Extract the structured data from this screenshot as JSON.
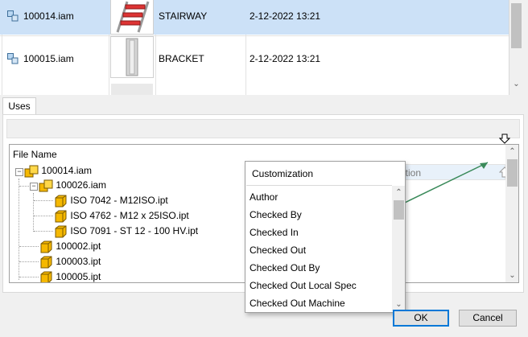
{
  "results": {
    "rows": [
      {
        "file": "100014.iam",
        "description": "STAIRWAY",
        "date": "2-12-2022 13:21",
        "selected": true
      },
      {
        "file": "100015.iam",
        "description": "BRACKET",
        "date": "2-12-2022 13:21",
        "selected": false
      }
    ]
  },
  "uses_tab": {
    "label": "Uses"
  },
  "tree": {
    "header": "File Name",
    "items": [
      {
        "label": "100014.iam",
        "level": 0,
        "kind": "assembly"
      },
      {
        "label": "100026.iam",
        "level": 1,
        "kind": "assembly"
      },
      {
        "label": "ISO 7042 - M12ISO.ipt",
        "level": 2,
        "kind": "part"
      },
      {
        "label": "ISO 4762 - M12 x 25ISO.ipt",
        "level": 2,
        "kind": "part"
      },
      {
        "label": "ISO 7091 - ST 12 - 100 HV.ipt",
        "level": 2,
        "kind": "part"
      },
      {
        "label": "100002.ipt",
        "level": 1,
        "kind": "part"
      },
      {
        "label": "100003.ipt",
        "level": 1,
        "kind": "part"
      },
      {
        "label": "100005.ipt",
        "level": 1,
        "kind": "part"
      }
    ],
    "description_column": "Description"
  },
  "customization": {
    "title": "Customization",
    "items": [
      "Author",
      "Checked By",
      "Checked In",
      "Checked Out",
      "Checked Out By",
      "Checked Out Local Spec",
      "Checked Out Machine"
    ]
  },
  "buttons": {
    "ok": "OK",
    "cancel": "Cancel"
  },
  "colors": {
    "selection": "#cce1f7",
    "arrow": "#3a8a5a",
    "part_icon": "#f5b800",
    "accent": "#0078d7"
  }
}
